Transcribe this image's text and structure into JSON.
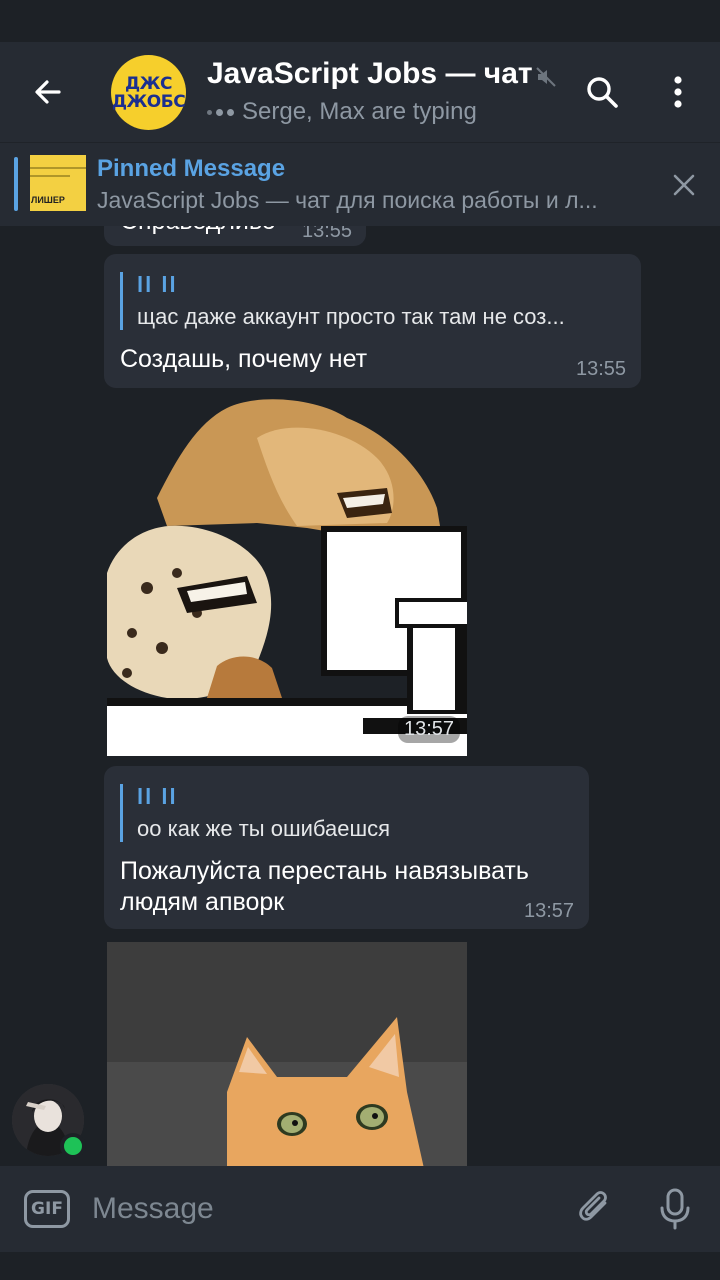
{
  "header": {
    "avatar_line1": "ДЖС",
    "avatar_line2": "ДЖОБС",
    "title": "JavaScript Jobs — чат",
    "typing_status": "Serge, Max are typing",
    "icons": [
      "back-arrow-icon",
      "mute-icon",
      "search-icon",
      "more-vert-icon"
    ]
  },
  "pinned": {
    "label": "Pinned Message",
    "text": "JavaScript Jobs — чат для поиска работы и л...",
    "thumb_label": "ЛИШЕР",
    "accent": "#5aa3e3"
  },
  "messages": [
    {
      "text": "Справедливо",
      "time": "13:55"
    },
    {
      "reply_name": "ll ll",
      "reply_text": "щас даже аккаунт просто так там не соз...",
      "text": "Создашь, почему нет",
      "time": "13:55"
    },
    {
      "type": "sticker",
      "time": "13:57"
    },
    {
      "reply_name": "ll ll",
      "reply_text": "оо как же ты ошибаешся",
      "text_line1": "Пожалуйста перестань навязывать",
      "text_line2": "людям апворк",
      "time": "13:57"
    },
    {
      "type": "photo"
    }
  ],
  "composer": {
    "gif_label": "GIF",
    "placeholder": "Message",
    "icons": [
      "gif-icon",
      "attach-icon",
      "mic-icon"
    ]
  },
  "colors": {
    "background": "#1d2126",
    "bar": "#262b33",
    "bubble": "#2a2f38",
    "accent": "#5aa3e3",
    "online": "#1ec257"
  }
}
